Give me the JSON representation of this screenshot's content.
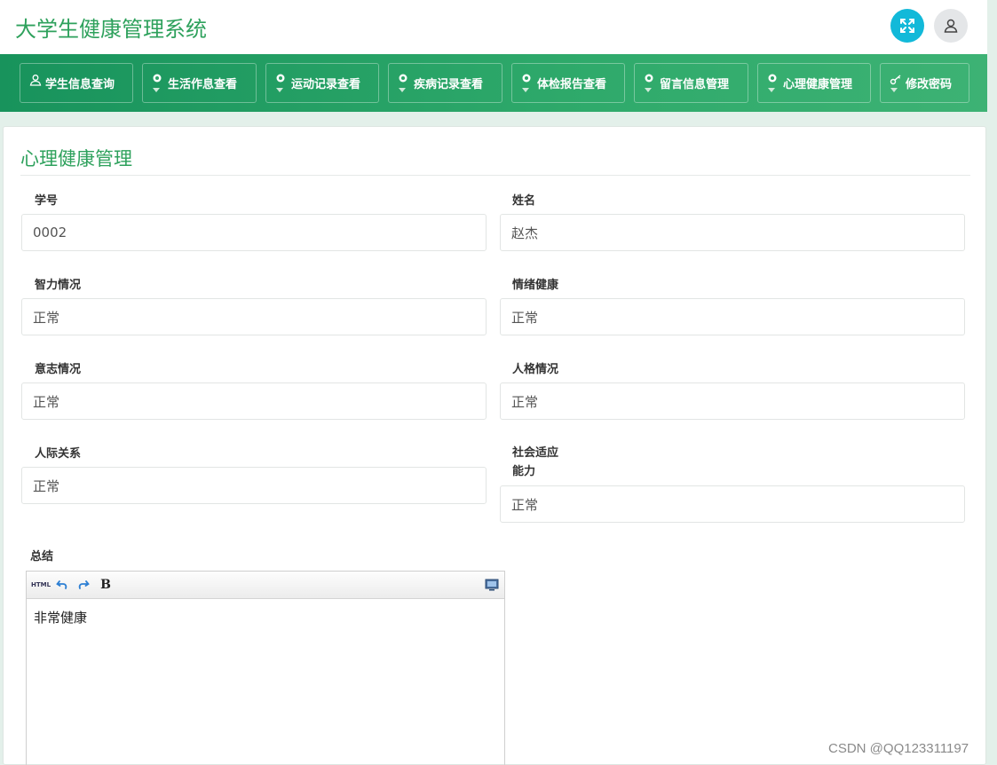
{
  "app": {
    "title": "大学生健康管理系统"
  },
  "nav": [
    {
      "label": "学生信息查询",
      "icon": "user-icon"
    },
    {
      "label": "生活作息查看",
      "icon": "leaf-icon"
    },
    {
      "label": "运动记录查看",
      "icon": "leaf-icon"
    },
    {
      "label": "疾病记录查看",
      "icon": "leaf-icon"
    },
    {
      "label": "体检报告查看",
      "icon": "leaf-icon"
    },
    {
      "label": "留言信息管理",
      "icon": "leaf-icon"
    },
    {
      "label": "心理健康管理",
      "icon": "leaf-icon"
    },
    {
      "label": "修改密码",
      "icon": "key-icon"
    }
  ],
  "panel": {
    "title": "心理健康管理",
    "fields": {
      "student_id": {
        "label": "学号",
        "value": "0002"
      },
      "name": {
        "label": "姓名",
        "value": "赵杰"
      },
      "intelligence": {
        "label": "智力情况",
        "value": "正常"
      },
      "emotion": {
        "label": "情绪健康",
        "value": "正常"
      },
      "will": {
        "label": "意志情况",
        "value": "正常"
      },
      "personality": {
        "label": "人格情况",
        "value": "正常"
      },
      "interpersonal": {
        "label": "人际关系",
        "value": "正常"
      },
      "social_line1": "社会适应",
      "social_line2": "能力",
      "social_value": "正常"
    },
    "summary": {
      "label": "总结",
      "toolbar_html": "HTML",
      "toolbar_bold": "B",
      "content": "非常健康"
    }
  },
  "watermark": "CSDN @QQ123311197",
  "colors": {
    "accent": "#2ea15c",
    "nav_start": "#18935c",
    "nav_end": "#3db274",
    "fullscreen_btn": "#12b9d9"
  }
}
